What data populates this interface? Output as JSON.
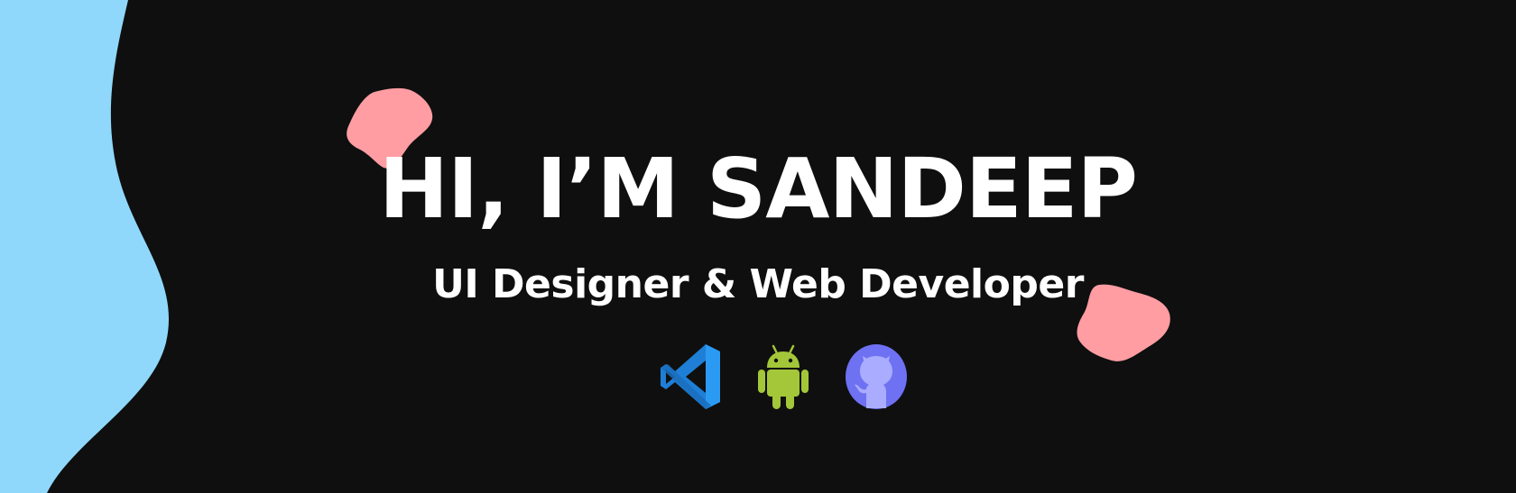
{
  "hero": {
    "greeting": "HI, I’M SANDEEP",
    "subtitle": "UI Designer & Web Developer"
  },
  "icons": [
    "vscode-icon",
    "android-icon",
    "github-icon"
  ],
  "colors": {
    "background": "#0f0f0f",
    "wave": "#8fd8fb",
    "blob": "#ff9da3",
    "text": "#ffffff",
    "vscode": "#1f7fd6",
    "android": "#a4c639",
    "github": "#6e71f2"
  }
}
